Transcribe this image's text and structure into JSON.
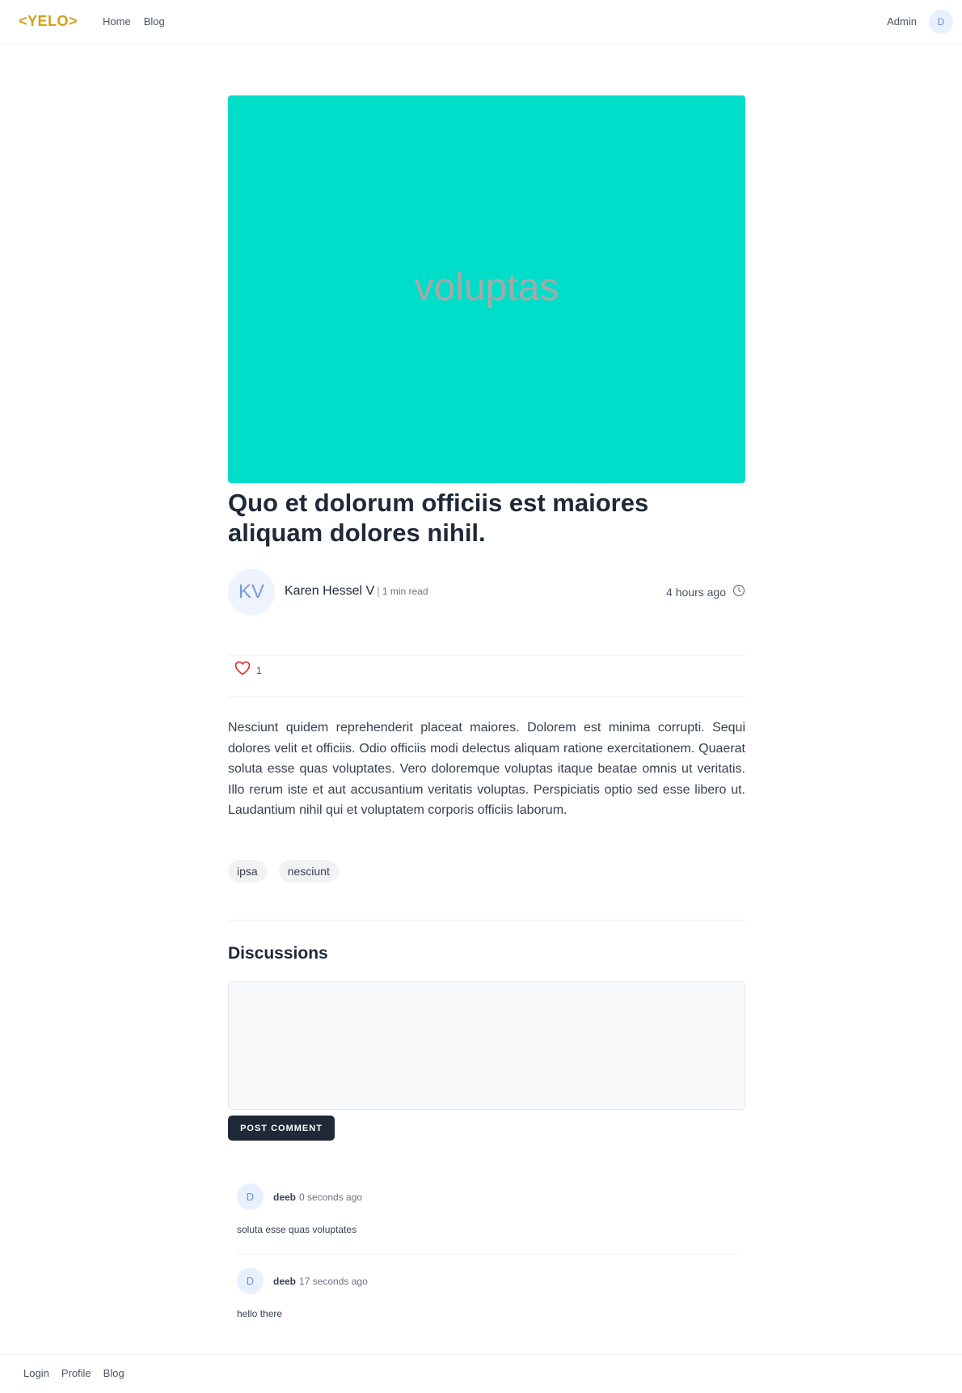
{
  "header": {
    "logo": "<YELO>",
    "nav": [
      "Home",
      "Blog"
    ],
    "admin_label": "Admin",
    "user_initial": "D"
  },
  "post": {
    "image_text": "voluptas",
    "image_color": "#00ddc9",
    "title": "Quo et dolorum officiis est maiores aliquam dolores nihil.",
    "author_initials": "KV",
    "author_name": "Karen Hessel V",
    "separator": "|",
    "read_time": "1 min read",
    "time_ago": "4 hours ago",
    "like_count": "1",
    "body": "Nesciunt quidem reprehenderit placeat maiores. Dolorem est minima corrupti. Sequi dolores velit et officiis. Odio officiis modi delectus aliquam ratione exercitationem. Quaerat soluta esse quas voluptates. Vero doloremque voluptas itaque beatae omnis ut veritatis. Illo rerum iste et aut accusantium veritatis voluptas. Perspiciatis optio sed esse libero ut. Laudantium nihil qui et voluptatem corporis officiis laborum.",
    "tags": [
      "ipsa",
      "nesciunt"
    ]
  },
  "discussions": {
    "heading": "Discussions",
    "comment_value": "",
    "post_button": "POST COMMENT",
    "comments": [
      {
        "initial": "D",
        "user": "deeb",
        "time": "0 seconds ago",
        "text": "soluta esse quas voluptates"
      },
      {
        "initial": "D",
        "user": "deeb",
        "time": "17 seconds ago",
        "text": "hello there"
      }
    ]
  },
  "footer": {
    "links": [
      "Login",
      "Profile",
      "Blog"
    ]
  }
}
